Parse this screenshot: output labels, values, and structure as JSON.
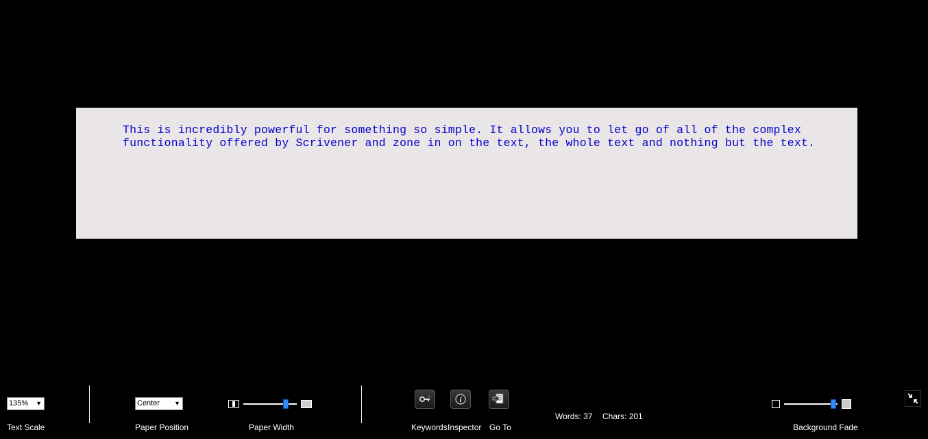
{
  "editor": {
    "text": "This is incredibly powerful for something so simple. It allows you to let go of all of the complex functionality offered by Scrivener and zone in on the text, the whole text and nothing but the text. "
  },
  "toolbar": {
    "text_scale": {
      "label": "Text Scale",
      "value": "135%"
    },
    "paper_position": {
      "label": "Paper Position",
      "value": "Center"
    },
    "paper_width": {
      "label": "Paper Width"
    },
    "keywords": {
      "label": "Keywords"
    },
    "inspector": {
      "label": "Inspector"
    },
    "goto": {
      "label": "Go To"
    },
    "stats": {
      "words_label": "Words:",
      "words_value": "37",
      "chars_label": "Chars:",
      "chars_value": "201"
    },
    "background_fade": {
      "label": "Background Fade"
    }
  }
}
